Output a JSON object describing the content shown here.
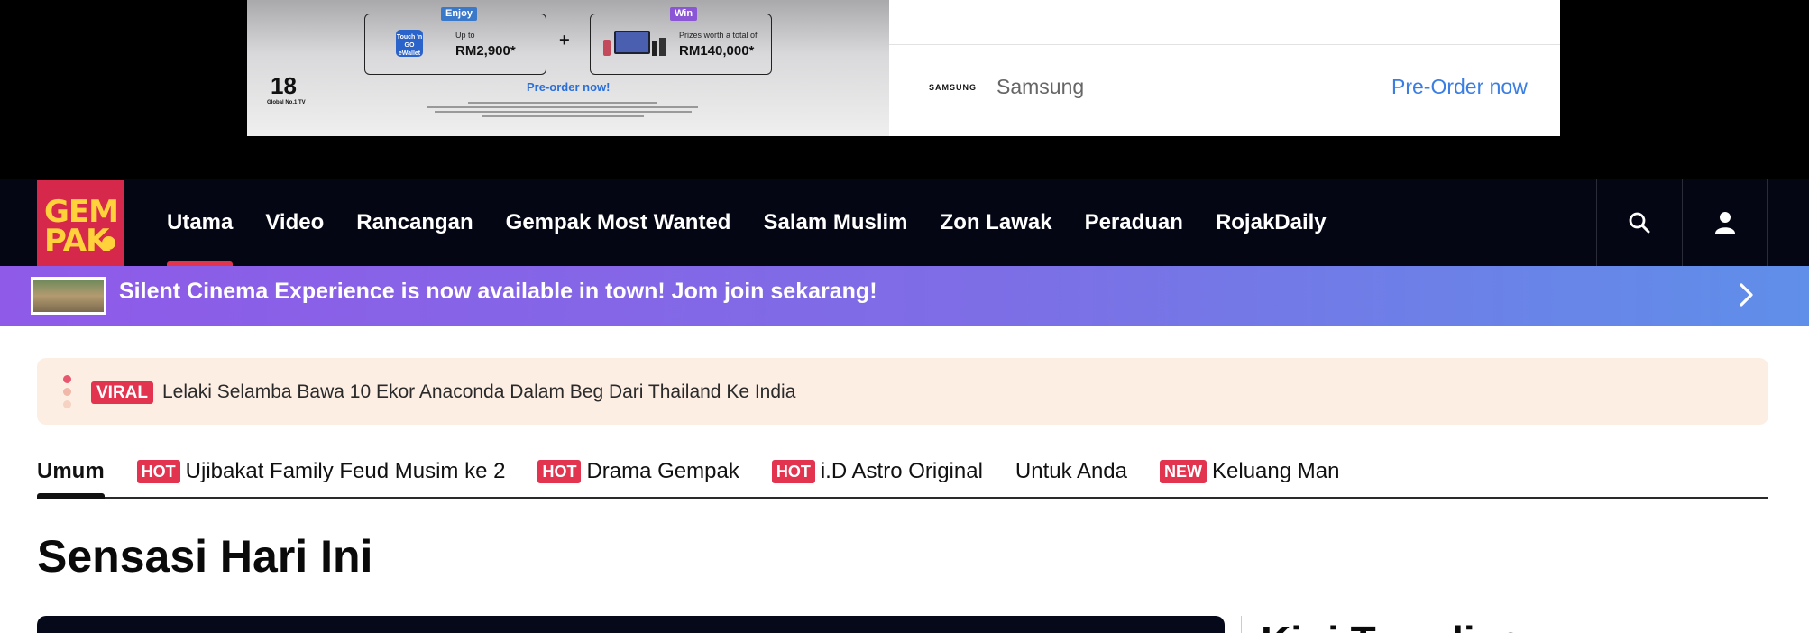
{
  "ad": {
    "creative": {
      "enjoy_tag": "Enjoy",
      "win_tag": "Win",
      "enjoy_prefix": "Up to",
      "enjoy_amount": "RM2,900*",
      "tng_label": "Touch 'n GO eWallet",
      "win_prefix": "Prizes worth a total of",
      "win_amount": "RM140,000*",
      "plus": "+",
      "preorder_link": "Pre-order now!",
      "badge_number": "18",
      "badge_caption": "Global No.1 TV"
    },
    "brand_logo": "SAMSUNG",
    "advertiser": "Samsung",
    "cta": "Pre-Order now"
  },
  "header": {
    "logo_line1": "GEM",
    "logo_line2": "PAK",
    "nav": [
      {
        "label": "Utama",
        "active": true
      },
      {
        "label": "Video"
      },
      {
        "label": "Rancangan"
      },
      {
        "label": "Gempak Most Wanted"
      },
      {
        "label": "Salam Muslim"
      },
      {
        "label": "Zon Lawak"
      },
      {
        "label": "Peraduan"
      },
      {
        "label": "RojakDaily"
      }
    ],
    "icons": {
      "search": "search-icon",
      "account": "user-icon"
    }
  },
  "promo": {
    "text": "Silent Cinema Experience is now available in town! Jom join sekarang!"
  },
  "ticker": {
    "badge": "VIRAL",
    "headline": "Lelaki Selamba Bawa 10 Ekor Anaconda Dalam Beg Dari Thailand Ke India"
  },
  "tabs": [
    {
      "label": "Umum",
      "badge": "",
      "active": true
    },
    {
      "label": "Ujibakat Family Feud Musim ke 2",
      "badge": "HOT"
    },
    {
      "label": "Drama Gempak",
      "badge": "HOT"
    },
    {
      "label": "i.D Astro Original",
      "badge": "HOT"
    },
    {
      "label": "Untuk Anda",
      "badge": ""
    },
    {
      "label": "Keluang Man",
      "badge": "NEW"
    }
  ],
  "section": {
    "title": "Sensasi Hari Ini",
    "sidebar_title": "Kini Trending"
  },
  "colors": {
    "header_bg": "#040613",
    "brand_red": "#e2334f",
    "logo_yellow": "#ffd23c",
    "promo_gradient_start": "#8f5ae8",
    "promo_gradient_end": "#5f8fe9",
    "ticker_bg": "#fdeee4",
    "ad_cta_blue": "#3a7ee3"
  }
}
